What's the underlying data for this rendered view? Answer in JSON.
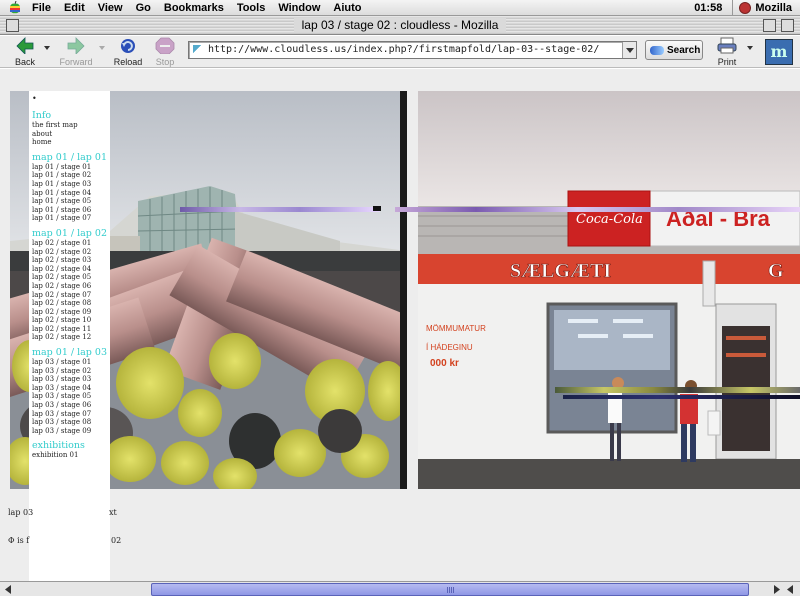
{
  "menubar": {
    "items": [
      "File",
      "Edit",
      "View",
      "Go",
      "Bookmarks",
      "Tools",
      "Window",
      "Aiuto"
    ],
    "clock": "01:58",
    "app_name": "Mozilla"
  },
  "window": {
    "title": "lap 03 / stage 02 : cloudless - Mozilla"
  },
  "toolbar": {
    "back_label": "Back",
    "forward_label": "Forward",
    "reload_label": "Reload",
    "stop_label": "Stop",
    "url": "http://www.cloudless.us/index.php?/firstmapfold/lap-03--stage-02/",
    "search_label": "Search",
    "print_label": "Print",
    "logo_letter": "m"
  },
  "sidebar": {
    "dot": "•",
    "sections": [
      {
        "title": "Info",
        "links": [
          "the first map",
          "about",
          "home"
        ]
      },
      {
        "title": "map 01 / lap 01",
        "links": [
          "lap 01 / stage 01",
          "lap 01 / stage 02",
          "lap 01 / stage 03",
          "lap 01 / stage 04",
          "lap 01 / stage 05",
          "lap 01 / stage 06",
          "lap 01 / stage 07"
        ]
      },
      {
        "title": "map 01 / lap 02",
        "links": [
          "lap 02 / stage 01",
          "lap 02 / stage 02",
          "lap 02 / stage 03",
          "lap 02 / stage 04",
          "lap 02 / stage 05",
          "lap 02 / stage 06",
          "lap 02 / stage 07",
          "lap 02 / stage 08",
          "lap 02 / stage 09",
          "lap 02 / stage 10",
          "lap 02 / stage 11",
          "lap 02 / stage 12"
        ]
      },
      {
        "title": "map 01 / lap 03",
        "links": [
          "lap 03 / stage 01",
          "lap 03 / stage 02",
          "lap 03 / stage 03",
          "lap 03 / stage 04",
          "lap 03 / stage 05",
          "lap 03 / stage 06",
          "lap 03 / stage 07",
          "lap 03 / stage 08",
          "lap 03 / stage 09"
        ]
      },
      {
        "title": "exhibitions",
        "links": [
          "exhibition 01"
        ]
      }
    ]
  },
  "body": {
    "caption_start": "lap 03",
    "caption_end": "xt",
    "footer_start": "Φ is f",
    "footer_end": "02"
  },
  "photos": {
    "left_alt_colors": {
      "sky": "#cfd3d8",
      "pipe": "#c9a3a0",
      "pipe_end": "#d9d85a"
    },
    "right_sign_text": "SÆLGÆTI",
    "right_window_text_1": "MÖMMUMATUR",
    "right_window_text_2": "Í HÁDEGINU",
    "right_window_text_3": "000 kr",
    "right_top_sign": "Aðal - Bra",
    "coke_text": "Coca-Cola",
    "right_edge_text": "G"
  }
}
